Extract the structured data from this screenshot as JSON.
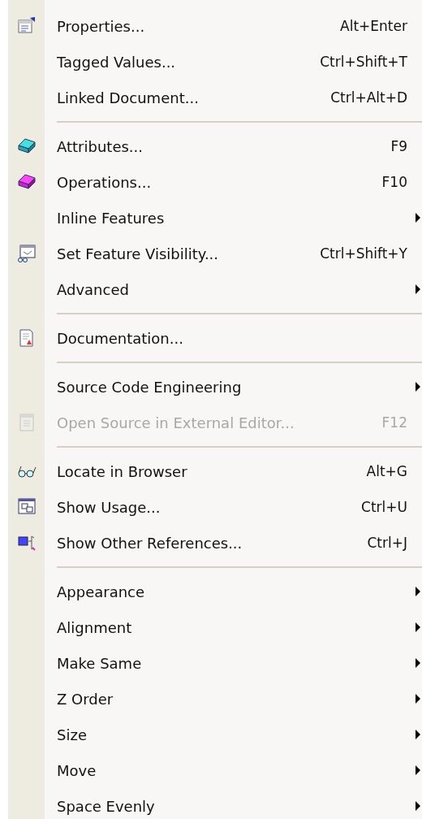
{
  "menu": {
    "items": [
      {
        "kind": "item",
        "label": "Properties...",
        "shortcut": "Alt+Enter",
        "submenu": false,
        "disabled": false
      },
      {
        "kind": "item",
        "label": "Tagged Values...",
        "shortcut": "Ctrl+Shift+T",
        "submenu": false,
        "disabled": false
      },
      {
        "kind": "item",
        "label": "Linked Document...",
        "shortcut": "Ctrl+Alt+D",
        "submenu": false,
        "disabled": false
      },
      {
        "kind": "separator"
      },
      {
        "kind": "item",
        "label": "Attributes...",
        "shortcut": "F9",
        "submenu": false,
        "disabled": false
      },
      {
        "kind": "item",
        "label": "Operations...",
        "shortcut": "F10",
        "submenu": false,
        "disabled": false
      },
      {
        "kind": "item",
        "label": "Inline Features",
        "submenu": true,
        "disabled": false
      },
      {
        "kind": "item",
        "label": "Set Feature Visibility...",
        "shortcut": "Ctrl+Shift+Y",
        "submenu": false,
        "disabled": false
      },
      {
        "kind": "item",
        "label": "Advanced",
        "submenu": true,
        "disabled": false
      },
      {
        "kind": "separator"
      },
      {
        "kind": "item",
        "label": "Documentation...",
        "submenu": false,
        "disabled": false
      },
      {
        "kind": "separator"
      },
      {
        "kind": "item",
        "label": "Source Code Engineering",
        "submenu": true,
        "disabled": false
      },
      {
        "kind": "item",
        "label": "Open Source in External Editor...",
        "shortcut": "F12",
        "submenu": false,
        "disabled": true
      },
      {
        "kind": "separator"
      },
      {
        "kind": "item",
        "label": "Locate in Browser",
        "shortcut": "Alt+G",
        "submenu": false,
        "disabled": false
      },
      {
        "kind": "item",
        "label": "Show Usage...",
        "shortcut": "Ctrl+U",
        "submenu": false,
        "disabled": false
      },
      {
        "kind": "item",
        "label": "Show Other References...",
        "shortcut": "Ctrl+J",
        "submenu": false,
        "disabled": false
      },
      {
        "kind": "separator"
      },
      {
        "kind": "item",
        "label": "Appearance",
        "submenu": true,
        "disabled": false
      },
      {
        "kind": "item",
        "label": "Alignment",
        "submenu": true,
        "disabled": false
      },
      {
        "kind": "item",
        "label": "Make Same",
        "submenu": true,
        "disabled": false
      },
      {
        "kind": "item",
        "label": "Z Order",
        "submenu": true,
        "disabled": false
      },
      {
        "kind": "item",
        "label": "Size",
        "submenu": true,
        "disabled": false
      },
      {
        "kind": "item",
        "label": "Move",
        "submenu": true,
        "disabled": false
      },
      {
        "kind": "item",
        "label": "Space Evenly",
        "submenu": true,
        "disabled": false
      }
    ]
  }
}
